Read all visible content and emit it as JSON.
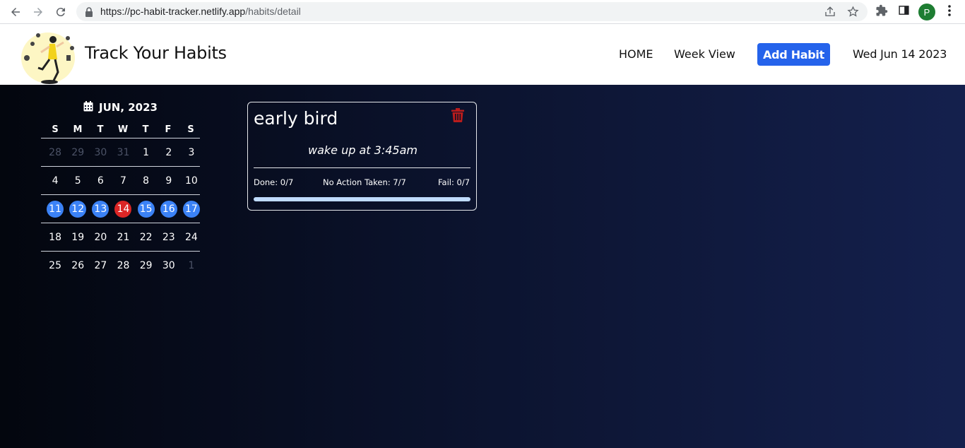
{
  "browser": {
    "url_host": "https://pc-habit-tracker.netlify.app",
    "url_path": "/habits/detail",
    "profile_initial": "P"
  },
  "header": {
    "brand": "Track Your Habits",
    "nav": {
      "home": "HOME",
      "week_view": "Week View",
      "add_habit": "Add Habit"
    },
    "today": "Wed Jun 14 2023"
  },
  "calendar": {
    "title": "JUN, 2023",
    "weekdays": [
      "S",
      "M",
      "T",
      "W",
      "T",
      "F",
      "S"
    ],
    "weeks": [
      [
        {
          "d": "28",
          "s": "muted"
        },
        {
          "d": "29",
          "s": "muted"
        },
        {
          "d": "30",
          "s": "muted"
        },
        {
          "d": "31",
          "s": "muted"
        },
        {
          "d": "1",
          "s": ""
        },
        {
          "d": "2",
          "s": ""
        },
        {
          "d": "3",
          "s": ""
        }
      ],
      [
        {
          "d": "4",
          "s": ""
        },
        {
          "d": "5",
          "s": ""
        },
        {
          "d": "6",
          "s": ""
        },
        {
          "d": "7",
          "s": ""
        },
        {
          "d": "8",
          "s": ""
        },
        {
          "d": "9",
          "s": ""
        },
        {
          "d": "10",
          "s": ""
        }
      ],
      [
        {
          "d": "11",
          "s": "sel"
        },
        {
          "d": "12",
          "s": "sel"
        },
        {
          "d": "13",
          "s": "sel"
        },
        {
          "d": "14",
          "s": "today"
        },
        {
          "d": "15",
          "s": "sel"
        },
        {
          "d": "16",
          "s": "sel"
        },
        {
          "d": "17",
          "s": "sel"
        }
      ],
      [
        {
          "d": "18",
          "s": ""
        },
        {
          "d": "19",
          "s": ""
        },
        {
          "d": "20",
          "s": ""
        },
        {
          "d": "21",
          "s": ""
        },
        {
          "d": "22",
          "s": ""
        },
        {
          "d": "23",
          "s": ""
        },
        {
          "d": "24",
          "s": ""
        }
      ],
      [
        {
          "d": "25",
          "s": ""
        },
        {
          "d": "26",
          "s": ""
        },
        {
          "d": "27",
          "s": ""
        },
        {
          "d": "28",
          "s": ""
        },
        {
          "d": "29",
          "s": ""
        },
        {
          "d": "30",
          "s": ""
        },
        {
          "d": "1",
          "s": "muted"
        }
      ]
    ]
  },
  "habit": {
    "name": "early bird",
    "description": "wake up at 3:45am",
    "done": "Done: 0/7",
    "no_action": "No Action Taken: 7/7",
    "fail": "Fail: 0/7",
    "progress_fraction": 0
  },
  "colors": {
    "accent": "#2563eb",
    "selected_day": "#3b82f6",
    "today_day": "#dc2626",
    "delete_icon": "#b91c1c"
  },
  "icons": [
    "back-icon",
    "forward-icon",
    "reload-icon",
    "lock-icon",
    "share-icon",
    "star-icon",
    "extensions-icon",
    "side-panel-icon",
    "menu-icon",
    "calendar-icon",
    "trash-icon"
  ]
}
